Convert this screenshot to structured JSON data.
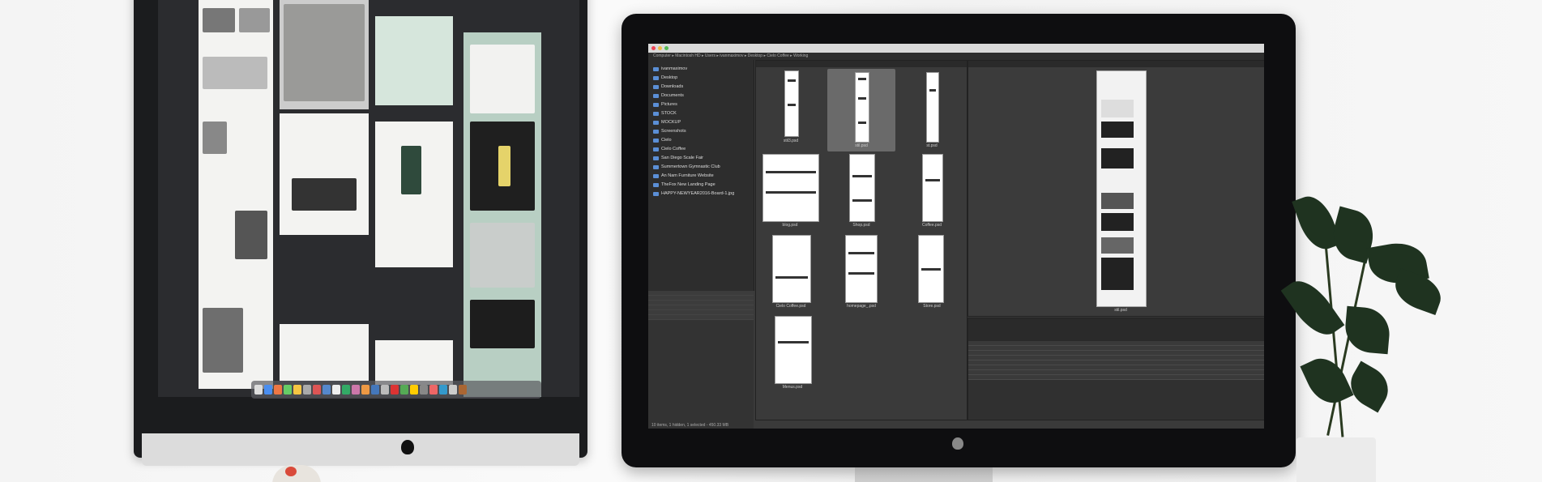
{
  "scene": "two-monitors-desk-with-plant",
  "left_monitor": {
    "app": "design-layout-grid"
  },
  "right_monitor": {
    "app": "file-browser",
    "pathbar": "Computer ▸ Macintosh HD ▸ Users ▸ ivanmaximov ▸ Desktop ▸ Cielo Coffee ▸ Working",
    "folders": [
      "ivanmaximov",
      "Desktop",
      "Downloads",
      "Documents",
      "Pictures",
      "STOCK",
      "MOCKUP",
      "Screenshots",
      "Cielo",
      "Cielo Coffee",
      "San Diego Scale Fair",
      "Summertown Gymnastic Club",
      "An Nam Furniture Website",
      "TheFox New Landing Page",
      "HAPPY-NEWYEAR2016-Board-1.jpg"
    ],
    "files": [
      {
        "label": "stil3.psd"
      },
      {
        "label": "stil.psd"
      },
      {
        "label": "st.psd"
      },
      {
        "label": "blog.psd"
      },
      {
        "label": "Shop.psd"
      },
      {
        "label": "Coffee.psd"
      },
      {
        "label": "Cielo Coffee.psd"
      },
      {
        "label": "homepage_.psd"
      },
      {
        "label": "Store.psd"
      },
      {
        "label": "Menus.psd"
      }
    ],
    "status": "10 items, 1 hidden, 1 selected - 450.33 MB",
    "preview_label": "stil.psd"
  }
}
